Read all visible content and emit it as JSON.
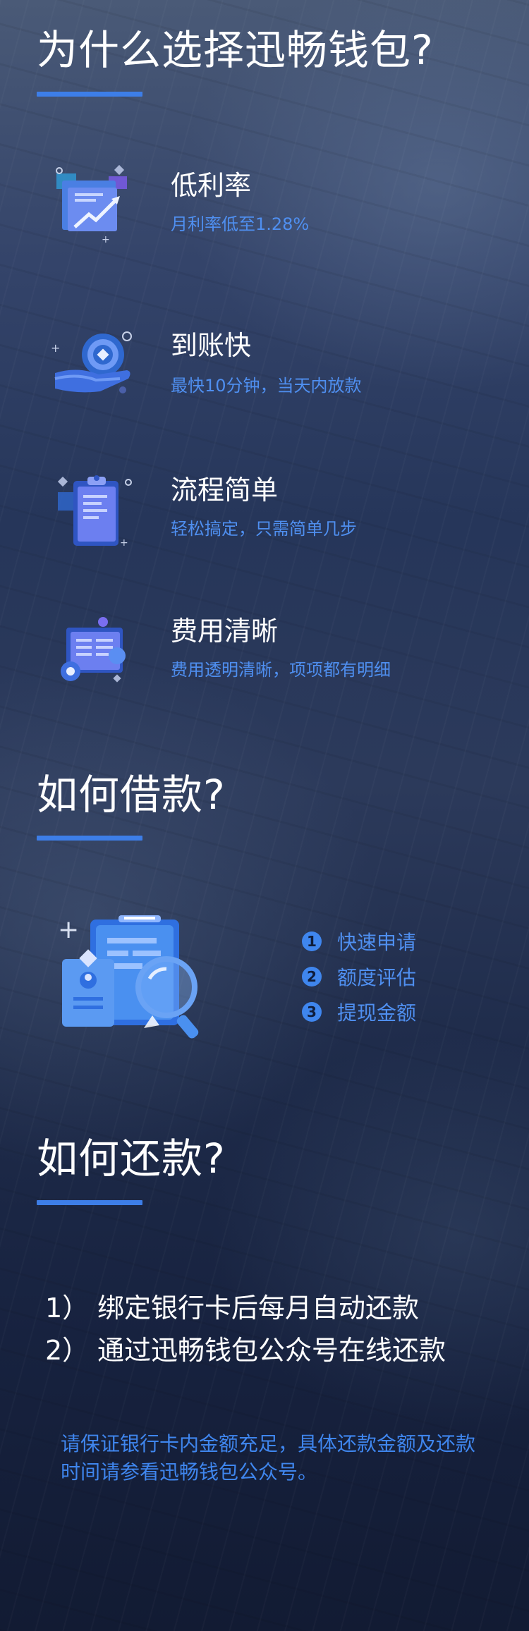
{
  "colors": {
    "accent": "#3d7ee8",
    "text_blue": "#4f8ff0",
    "title_white": "#ffffff"
  },
  "why_section": {
    "title": "为什么选择迅畅钱包?",
    "features": [
      {
        "icon": "growth-chart-icon",
        "title": "低利率",
        "desc": "月利率低至1.28%"
      },
      {
        "icon": "coin-hand-icon",
        "title": "到账快",
        "desc": "最快10分钟，当天内放款"
      },
      {
        "icon": "clipboard-icon",
        "title": "流程简单",
        "desc": "轻松搞定，只需简单几步"
      },
      {
        "icon": "bill-details-icon",
        "title": "费用清晰",
        "desc": "费用透明清晰，项项都有明细"
      }
    ]
  },
  "borrow_section": {
    "title": "如何借款?",
    "illustration": "document-magnifier-icon",
    "steps": [
      {
        "num": "1",
        "label": "快速申请"
      },
      {
        "num": "2",
        "label": "额度评估"
      },
      {
        "num": "3",
        "label": "提现金额"
      }
    ]
  },
  "repay_section": {
    "title": "如何还款?",
    "items": [
      {
        "idx": "1）",
        "text": "绑定银行卡后每月自动还款"
      },
      {
        "idx": "2）",
        "text": "通过迅畅钱包公众号在线还款"
      }
    ],
    "note": "请保证银行卡内金额充足，具体还款金额及还款时间请参看迅畅钱包公众号。"
  }
}
